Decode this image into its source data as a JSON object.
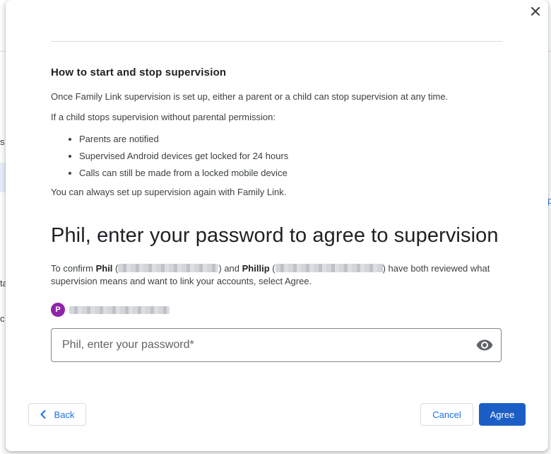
{
  "background": {
    "fragments": [
      "s",
      "ta",
      "c",
      "p"
    ]
  },
  "dialog": {
    "close_icon": "close-icon",
    "section": {
      "title": "How to start and stop supervision",
      "intro": "Once Family Link supervision is set up, either a parent or a child can stop supervision at any time.",
      "condition": "If a child stops supervision without parental permission:",
      "bullets": [
        "Parents are notified",
        "Supervised Android devices get locked for 24 hours",
        "Calls can still be made from a locked mobile device"
      ],
      "outro": "You can always set up supervision again with Family Link."
    },
    "title": "Phil, enter your password to agree to supervision",
    "confirm": {
      "prefix": "To confirm ",
      "parent_name": "Phil",
      "middle": " and ",
      "child_name": "Phillip",
      "suffix": " have both reviewed what supervision means and want to link your accounts, select Agree."
    },
    "account": {
      "avatar_letter": "P",
      "avatar_color": "#8e24aa"
    },
    "password": {
      "placeholder": "Phil, enter your password*",
      "value": "",
      "toggle_icon": "eye-icon"
    },
    "buttons": {
      "back": "Back",
      "cancel": "Cancel",
      "agree": "Agree"
    },
    "colors": {
      "accent": "#1a73e8",
      "primary_button": "#1b5fc6"
    }
  }
}
